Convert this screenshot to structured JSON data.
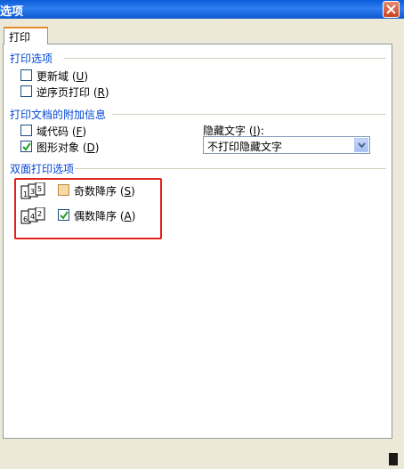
{
  "window": {
    "title": "选项"
  },
  "tabs": [
    {
      "label": "打印"
    }
  ],
  "groups": {
    "print_options": {
      "title": "打印选项",
      "items": [
        {
          "label": "更新域",
          "key": "U",
          "checked": false
        },
        {
          "label": "逆序页打印",
          "key": "R",
          "checked": false
        }
      ]
    },
    "document_info": {
      "title": "打印文档的附加信息",
      "items": [
        {
          "label": "域代码",
          "key": "F",
          "checked": false
        },
        {
          "label": "图形对象",
          "key": "D",
          "checked": true
        }
      ],
      "hidden_text": {
        "label": "隐藏文字",
        "key": "I",
        "suffix": ":",
        "selected": "不打印隐藏文字"
      }
    },
    "duplex": {
      "title": "双面打印选项",
      "items": [
        {
          "label": "奇数降序",
          "key": "S",
          "checked": false,
          "icon_pages": [
            "1",
            "3",
            "5"
          ]
        },
        {
          "label": "偶数降序",
          "key": "A",
          "checked": true,
          "icon_pages": [
            "6",
            "4",
            "2"
          ]
        }
      ]
    }
  },
  "colors": {
    "group_title": "#0046d5",
    "highlight_border": "#e2231a",
    "titlebar": "#0a5bd8"
  }
}
